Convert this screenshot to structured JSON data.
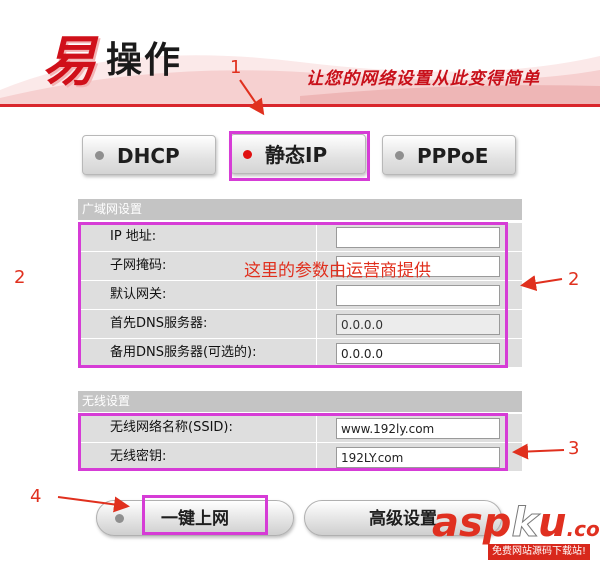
{
  "header": {
    "logo_big": "易",
    "logo_small": "操作",
    "slogan": "让您的网络设置从此变得简单"
  },
  "modes": {
    "dhcp": "DHCP",
    "static_ip": "静态IP",
    "pppoe": "PPPoE",
    "selected": "static_ip"
  },
  "wan": {
    "title": "广域网设置",
    "rows": [
      {
        "label": "IP 地址:",
        "value": "",
        "placeholder": ""
      },
      {
        "label": "子网掩码:",
        "value": "",
        "placeholder": ""
      },
      {
        "label": "默认网关:",
        "value": "",
        "placeholder": ""
      },
      {
        "label": "首先DNS服务器:",
        "value": "0.0.0.0",
        "placeholder": ""
      },
      {
        "label": "备用DNS服务器(可选的):",
        "value": "0.0.0.0",
        "placeholder": ""
      }
    ]
  },
  "wireless": {
    "title": "无线设置",
    "rows": [
      {
        "label": "无线网络名称(SSID):",
        "value": "www.192ly.com"
      },
      {
        "label": "无线密钥:",
        "value": "192LY.com"
      }
    ]
  },
  "actions": {
    "connect": "一键上网",
    "advanced": "高级设置"
  },
  "annotations": {
    "n1": "1",
    "n2_left": "2",
    "n2_right": "2",
    "n3": "3",
    "n4": "4",
    "note": "这里的参数由运营商提供",
    "accent_color": "#d63cd6",
    "text_color": "#e0301e"
  },
  "watermark": {
    "asp": "asp",
    "k": "k",
    "u": "u",
    "dom": ".com",
    "sub": "免费网站源码下载站!"
  },
  "colors": {
    "brand_red": "#d0101a",
    "panel_gray": "#dedede",
    "panel_head": "#c4c4c4"
  }
}
